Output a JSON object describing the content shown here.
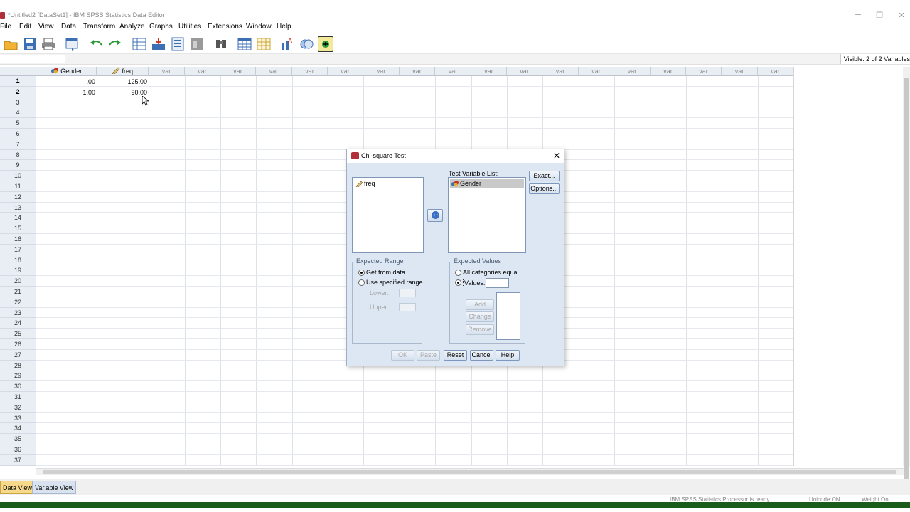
{
  "window": {
    "title": "*Untitled2 [DataSet1] - IBM SPSS Statistics Data Editor",
    "controls": [
      "─",
      "❐",
      "✕"
    ]
  },
  "menu": [
    "File",
    "Edit",
    "View",
    "Data",
    "Transform",
    "Analyze",
    "Graphs",
    "Utilities",
    "Extensions",
    "Window",
    "Help"
  ],
  "toolbar": {
    "icons": [
      "open-icon",
      "save-icon",
      "print-icon",
      "recall-dialog-icon",
      "undo-icon",
      "redo-icon",
      "goto-case-icon",
      "goto-variable-icon",
      "variables-icon",
      "run-descriptives-icon",
      "find-icon",
      "insert-cases-icon",
      "insert-variable-icon",
      "split-file-icon",
      "value-labels-icon",
      "use-sets-icon",
      "spellcheck-icon"
    ]
  },
  "info": {
    "visible": "Visible: 2 of 2 Variables"
  },
  "grid": {
    "columns": [
      "Gender",
      "freq",
      "var",
      "var",
      "var",
      "var",
      "var",
      "var",
      "var",
      "var",
      "var",
      "var",
      "var",
      "var",
      "var",
      "var",
      "var",
      "var",
      "var",
      "var"
    ],
    "rows": [
      [
        ".00",
        "125.00"
      ],
      [
        "1.00",
        "90.00"
      ]
    ],
    "row_numbers": [
      "1",
      "2",
      "3",
      "4",
      "5",
      "6",
      "7",
      "8",
      "9",
      "10",
      "11",
      "12",
      "13",
      "14",
      "15",
      "16",
      "17",
      "18",
      "19",
      "20",
      "21",
      "22",
      "23",
      "24",
      "25",
      "26",
      "27",
      "28",
      "29",
      "30",
      "31",
      "32",
      "33",
      "34",
      "35",
      "36",
      "37"
    ]
  },
  "tabs": {
    "data_view": "Data View",
    "variable_view": "Variable View"
  },
  "status": {
    "processor": "IBM SPSS Statistics Processor is ready",
    "unicode": "Unicode:ON",
    "weight": "Weight On"
  },
  "dialog": {
    "title": "Chi-square Test",
    "close": "✕",
    "source_list": [
      "freq"
    ],
    "test_variable_label": "Test Variable List:",
    "test_variables": [
      "Gender"
    ],
    "exact_button": "Exact...",
    "options_button": "Options...",
    "expected_range": {
      "legend": "Expected Range",
      "get_from_data": "Get from data",
      "use_specified": "Use specified range",
      "lower": "Lower:",
      "upper": "Upper:"
    },
    "expected_values": {
      "legend": "Expected Values",
      "all_equal": "All categories equal",
      "values": "Values:",
      "value_input": "",
      "add": "Add",
      "change": "Change",
      "remove": "Remove"
    },
    "buttons": {
      "ok": "OK",
      "paste": "Paste",
      "reset": "Reset",
      "cancel": "Cancel",
      "help": "Help"
    }
  }
}
